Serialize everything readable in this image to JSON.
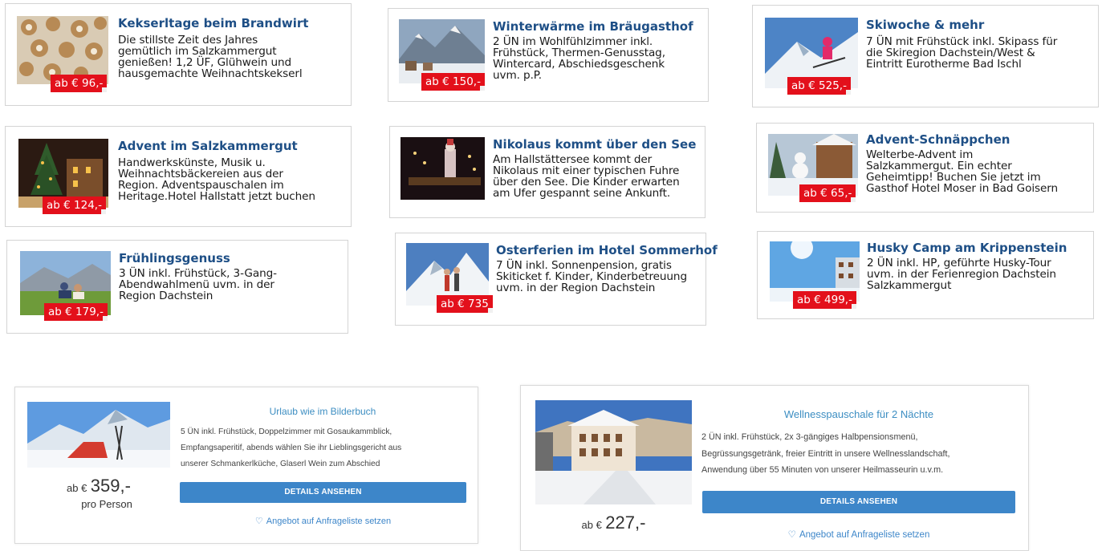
{
  "offers": [
    {
      "title": "Kekserltage beim Brandwirt",
      "text": "Die stillste Zeit des Jahres\ngemütlich im Salzkammergut\ngenießen! 1,2 ÜF, Glühwein und\nhausgemachte Weihnachtskekserl",
      "price": "ab € 96,-",
      "image": "christmas-cookies"
    },
    {
      "title": "Winterwärme im Bräugasthof",
      "text": "2 ÜN im Wohlfühlzimmer inkl.\nFrühstück, Thermen-Genusstag,\nWintercard, Abschiedsgeschenk\nuvm. p.P.",
      "price": "ab € 150,-",
      "image": "winter-lake-village"
    },
    {
      "title": "Skiwoche & mehr",
      "text": "7 ÜN mit Frühstück inkl. Skipass für\ndie Skiregion Dachstein/West &\nEintritt Eurotherme Bad Ischl",
      "price": "ab € 525,-",
      "image": "skier"
    },
    {
      "title": "Advent im Salzkammergut",
      "text": "Handwerkskünste, Musik u.\nWeihnachtsbäckereien aus der\nRegion. Adventspauschalen im\nHeritage.Hotel Hallstatt jetzt buchen",
      "price": "ab € 124,-",
      "image": "christmas-market"
    },
    {
      "title": "Nikolaus kommt über den See",
      "text": "Am Hallstättersee kommt der\nNikolaus mit einer typischen Fuhre\nüber den See. Die Kinder erwarten\nam Ufer gespannt seine Ankunft.",
      "price": "",
      "image": "nikolaus-boat"
    },
    {
      "title": "Advent-Schnäppchen",
      "text": "Welterbe-Advent im\nSalzkammergut. Ein echter\nGeheimtipp! Buchen Sie jetzt im\nGasthof Hotel Moser in Bad Goisern",
      "price": "ab € 65,-",
      "image": "snowy-hotel"
    },
    {
      "title": "Frühlingsgenuss",
      "text": "3 ÜN inkl. Frühstück, 3-Gang-\nAbendwahlmenü uvm. in der\nRegion Dachstein",
      "price": "ab € 179,-",
      "image": "spring-meadow"
    },
    {
      "title": "Osterferien im Hotel Sommerhof",
      "text": "7 ÜN inkl. Sonnenpension, gratis\nSkiticket f. Kinder, Kinderbetreuung\nuvm. in der Region Dachstein",
      "price": "ab € 735",
      "image": "ski-touring"
    },
    {
      "title": "Husky Camp am Krippenstein",
      "text": "2 ÜN inkl. HP, geführte Husky-Tour\nuvm. in der Ferienregion Dachstein\nSalzkammergut",
      "price": "ab € 499,-",
      "image": "sunny-snow-building"
    }
  ],
  "packages": [
    {
      "title": "Urlaub wie im Bilderbuch",
      "text": "5 ÜN inkl. Frühstück, Doppelzimmer mit Gosaukammblick,\nEmpfangsaperitif, abends wählen Sie ihr Lieblingsgericht aus\nunserer Schmankerlküche, Glaserl Wein zum Abschied",
      "price_prefix": "ab €",
      "price": "359,-",
      "price_note": "pro Person",
      "button": "DETAILS ANSEHEN",
      "wishlist": "Angebot auf Anfrageliste setzen",
      "image": "snow-mountain-sled"
    },
    {
      "title": "Wellnesspauschale für 2 Nächte",
      "text": "2 ÜN inkl. Frühstück, 2x 3-gängiges Halbpensionsmenü,\nBegrüssungsgetränk, freier Eintritt in unsere Wellnesslandschaft,\nAnwendung über 55 Minuten von unserer Heilmasseurin u.v.m.",
      "price_prefix": "ab €",
      "price": "227,-",
      "price_note": "",
      "button": "DETAILS ANSEHEN",
      "wishlist": "Angebot auf Anfrageliste setzen",
      "image": "winter-hotel"
    }
  ],
  "colors": {
    "title_blue": "#1e4f86",
    "price_red": "#e3101b",
    "package_title": "#3d8ec2",
    "button_blue": "#3d86c9"
  }
}
